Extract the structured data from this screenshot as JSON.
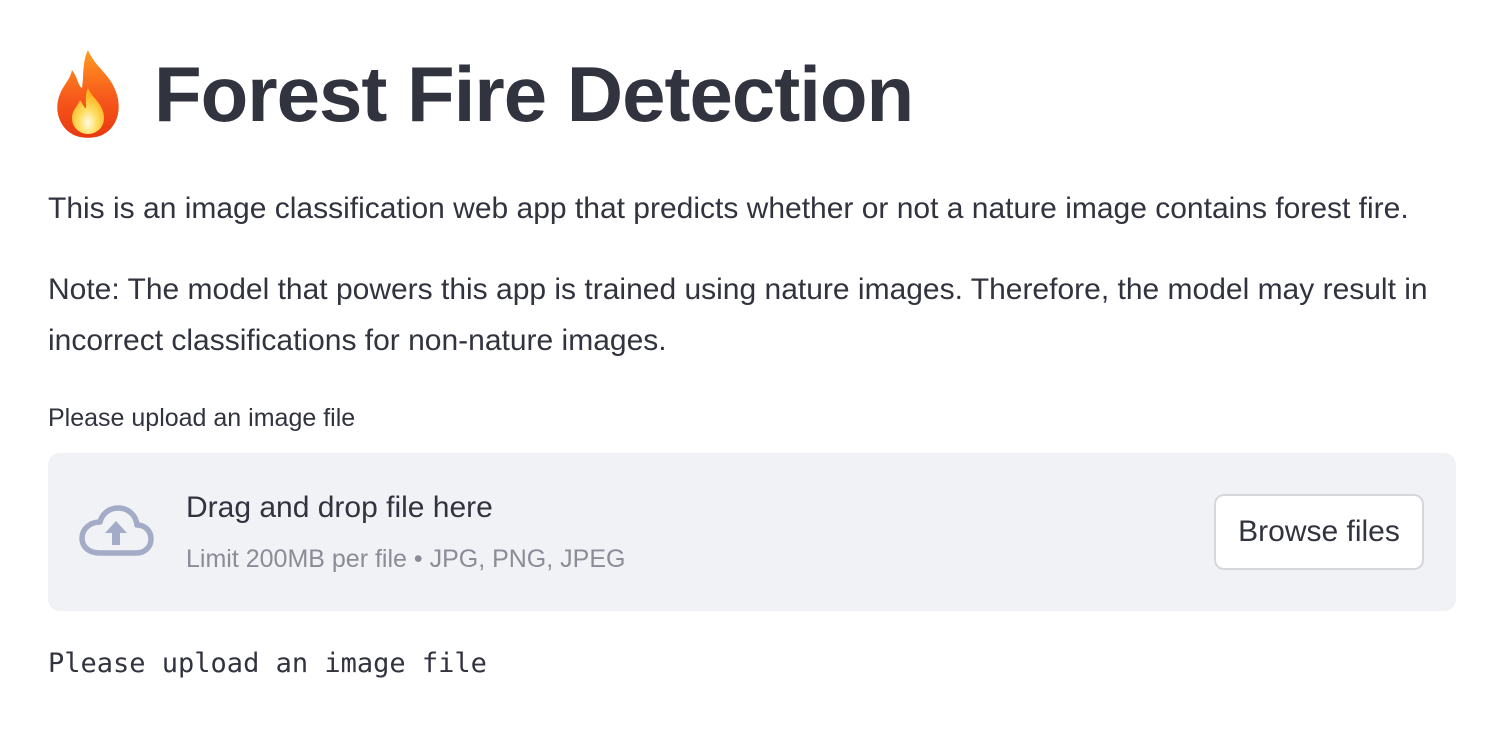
{
  "header": {
    "icon": "fire-icon",
    "title": "Forest Fire Detection"
  },
  "content": {
    "intro": "This is an image classification web app that predicts whether or not a nature image contains forest fire.",
    "note": "Note: The model that powers this app is trained using nature images. Therefore, the model may result in incorrect classifications for non-nature images."
  },
  "uploader": {
    "label": "Please upload an image file",
    "icon": "cloud-upload-icon",
    "drop_title": "Drag and drop file here",
    "limit_text": "Limit 200MB per file • JPG, PNG, JPEG",
    "browse_label": "Browse files"
  },
  "status": {
    "message": "Please upload an image file"
  },
  "colors": {
    "text": "#31333f",
    "muted": "#8a8d97",
    "dropzone_bg": "#f0f2f6",
    "icon": "#a3abc6"
  }
}
